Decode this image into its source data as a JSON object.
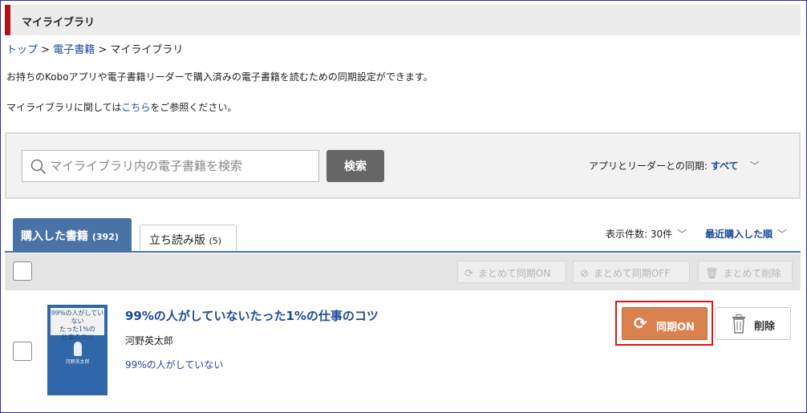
{
  "page_title": "マイライブラリ",
  "breadcrumb": {
    "home": "トップ",
    "sep1": " > ",
    "ebooks": "電子書籍",
    "sep2": " > ",
    "current": "マイライブラリ"
  },
  "description": {
    "line1": "お持ちのKoboアプリや電子書籍リーダーで購入済みの電子書籍を読むための同期設定ができます。",
    "line2_pre": "マイライブラリに関しては",
    "line2_link": "こちら",
    "line2_post": "をご参照ください。"
  },
  "search": {
    "placeholder": "マイライブラリ内の電子書籍を検索",
    "button_label": "検索",
    "sync_filter_label": "アプリとリーダーとの同期:",
    "sync_filter_value": "すべて"
  },
  "tabs": [
    {
      "label": "購入した書籍",
      "count": "(392)",
      "active": true
    },
    {
      "label": "立ち読み版",
      "count": "(5)",
      "active": false
    }
  ],
  "list_controls": {
    "per_page": "表示件数: 30件",
    "sort": "最近購入した順"
  },
  "bulk_actions": [
    {
      "label": "まとめて同期ON",
      "icon": "sync-icon"
    },
    {
      "label": "まとめて同期OFF",
      "icon": "sync-off-icon"
    },
    {
      "label": "まとめて削除",
      "icon": "trash-icon"
    }
  ],
  "book": {
    "title": "99%の人がしていないたった1%の仕事のコツ",
    "author": "河野英太郎",
    "series": "99%の人がしていない",
    "cover_top_line1": "99%の人がしていない",
    "cover_top_line2": "たった1%の",
    "cover_top_line3": "仕事のコツ",
    "cover_author": "河野英太郎",
    "sync_label": "同期ON",
    "delete_label": "削除"
  },
  "colors": {
    "accent_red": "#b0121b",
    "tab_blue": "#4a73a5",
    "link_blue": "#1a4b9a",
    "sync_orange": "#d9824f",
    "highlight_red": "#e01616"
  }
}
